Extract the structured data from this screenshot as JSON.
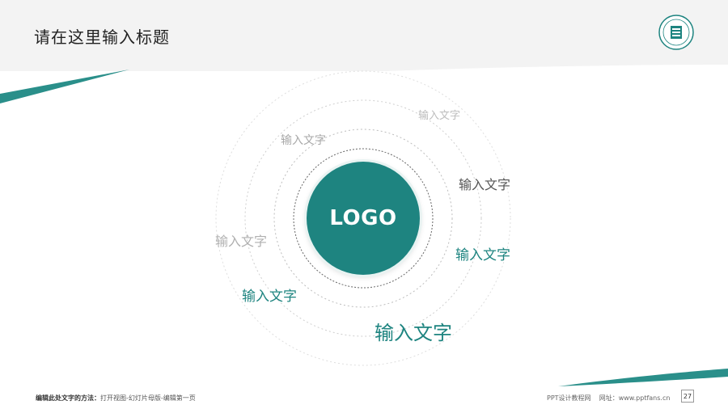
{
  "header": {
    "title": "请在这里输入标题"
  },
  "logo": {
    "label": "LOGO"
  },
  "labels": [
    "输入文字",
    "输入文字",
    "输入文字",
    "输入文字",
    "输入文字",
    "输入文字",
    "输入文字"
  ],
  "footer": {
    "hint_bold": "编辑此处文字的方法：",
    "hint_rest": "打开视图-幻灯片母版-编辑第一页",
    "site_prefix": "PPT设计教程网    网址：",
    "site_url": "www.pptfans.cn",
    "page_number": "27"
  },
  "colors": {
    "accent": "#1e8480",
    "header_bg": "#f3f3f3"
  },
  "icons": {
    "seal": "university-seal-icon"
  }
}
